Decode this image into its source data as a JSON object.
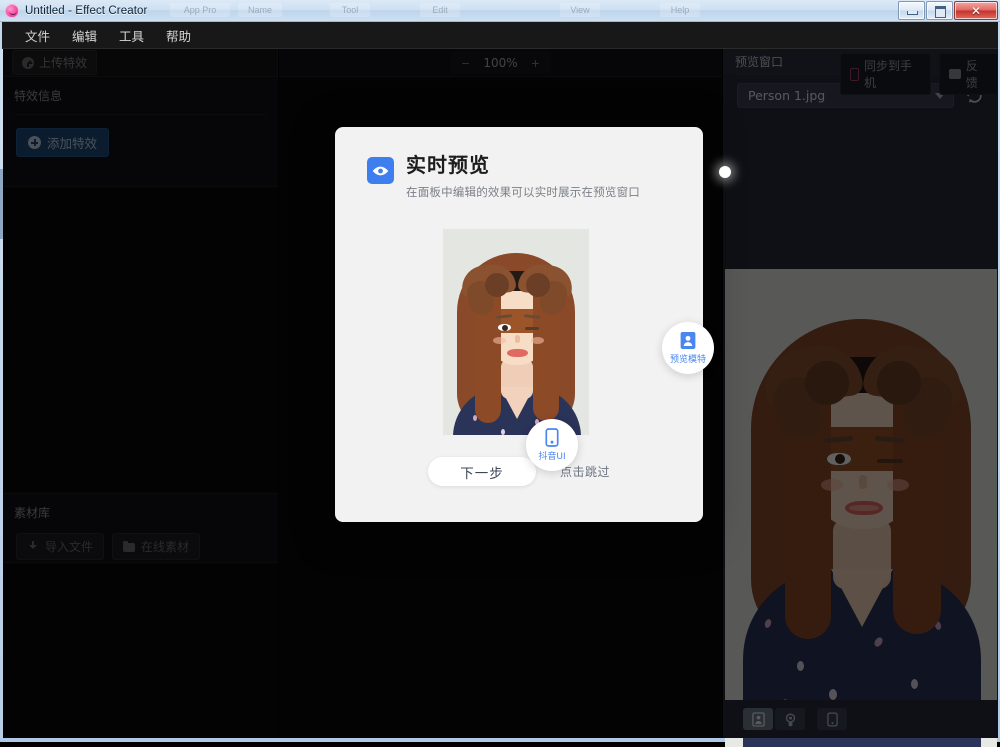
{
  "window": {
    "title": "Untitled - Effect Creator",
    "app_icon": "smiley-circle-icon",
    "controls": {
      "minimize": "minimize-icon",
      "maximize": "maximize-icon",
      "close": "close-icon"
    },
    "ghosts": [
      "App Pro",
      "Name",
      "Tool",
      "Edit",
      "View",
      "Help"
    ]
  },
  "menubar": {
    "items": [
      "文件",
      "编辑",
      "工具",
      "帮助"
    ]
  },
  "left_panel": {
    "upload_button": {
      "label": "上传特效",
      "icon": "upload-circle-icon"
    },
    "effect_info": {
      "title": "特效信息",
      "add_button": {
        "label": "添加特效",
        "icon": "plus-circle-icon",
        "color": "#1b4a7a"
      }
    },
    "material_library": {
      "title": "素材库",
      "buttons": [
        {
          "label": "导入文件",
          "icon": "download-icon"
        },
        {
          "label": "在线素材",
          "icon": "folder-icon"
        }
      ]
    }
  },
  "center": {
    "zoom": {
      "minus": "−",
      "value": "100%",
      "plus": "+"
    }
  },
  "toolbar_right": {
    "sync_button": {
      "label": "同步到手机",
      "icon": "phone-icon",
      "icon_color": "#9b3a4e"
    },
    "feedback_button": {
      "label": "反馈",
      "icon": "speech-bubble-icon"
    }
  },
  "right_panel": {
    "title": "预览窗口",
    "collapse_icon": "chevron-left-icon",
    "file_select": {
      "value": "Person 1.jpg",
      "caret": "chevron-down-icon"
    },
    "refresh_icon": "refresh-icon",
    "bottom_tools": [
      {
        "name": "portrait-preview",
        "icon": "portrait-icon",
        "active": true
      },
      {
        "name": "camera-preview",
        "icon": "camera-icon",
        "active": false
      },
      {
        "name": "phone-preview",
        "icon": "phone-frame-icon",
        "active": false
      }
    ]
  },
  "dialog": {
    "icon": "eye-icon",
    "title": "实时预览",
    "subtitle": "在面板中编辑的效果可以实时展示在预览窗口",
    "badges": [
      {
        "label": "预览模特",
        "icon": "portrait-card-icon"
      },
      {
        "label": "抖音UI",
        "icon": "phone-frame-icon"
      }
    ],
    "next_button": "下一步",
    "skip_link": "点击跳过",
    "accent_color": "#3e7eef",
    "background": "#f2f2f2"
  }
}
